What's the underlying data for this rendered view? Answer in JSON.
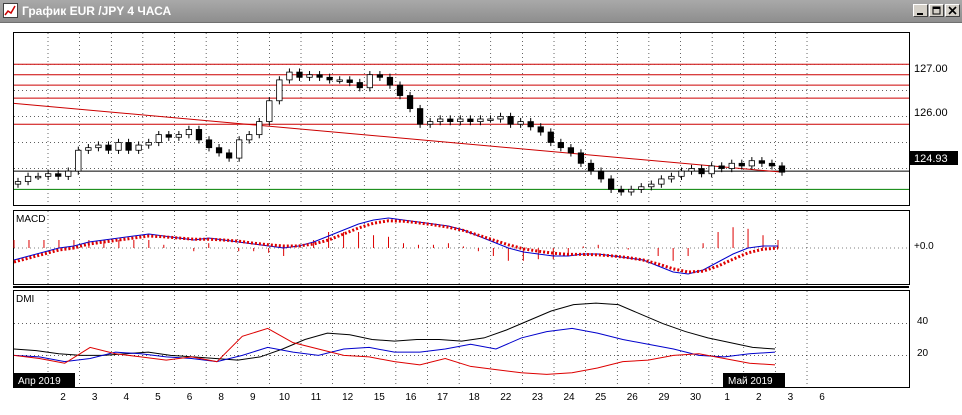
{
  "window": {
    "title": "График EUR /JPY  4 ЧАСА",
    "icons": {
      "app": "chart-app-icon",
      "minimize": "minimize-icon",
      "restore": "restore-icon",
      "close": "close-icon"
    }
  },
  "colors": {
    "candle_up": "#ffffff",
    "candle_down": "#000000",
    "resistance": "#cc0000",
    "support": "#008000",
    "trendline": "#cc0000",
    "macd_line": "#0000cc",
    "macd_signal": "#dd0000",
    "dmi_adx": "#000000",
    "dmi_plus": "#0000cc",
    "dmi_minus": "#dd0000",
    "price_badge_bg": "#000000",
    "price_badge_fg": "#ffffff"
  },
  "price_panel": {
    "current_price": "124.93",
    "ticks": [
      "127.00",
      "126.00"
    ]
  },
  "macd_panel": {
    "label": "MACD",
    "ticks": [
      "+0.0"
    ]
  },
  "dmi_panel": {
    "label": "DMI",
    "ticks": [
      "40",
      "20"
    ]
  },
  "time_axis": {
    "month_labels": [
      "Апр 2019",
      "Май 2019"
    ],
    "day_labels": [
      "2",
      "3",
      "4",
      "5",
      "6",
      "8",
      "9",
      "10",
      "11",
      "12",
      "15",
      "16",
      "17",
      "18",
      "22",
      "23",
      "24",
      "25",
      "26",
      "29",
      "30",
      "1",
      "2",
      "3",
      "6"
    ]
  },
  "chart_data": {
    "type": "candlestick",
    "symbol": "EUR/JPY",
    "timeframe": "4H",
    "y_range": [
      124.3,
      127.6
    ],
    "horizontal_levels": [
      {
        "value": 127.0,
        "color": "#cc0000"
      },
      {
        "value": 126.8,
        "color": "#cc0000"
      },
      {
        "value": 126.6,
        "color": "#cc0000"
      },
      {
        "value": 126.35,
        "color": "#cc0000"
      },
      {
        "value": 125.85,
        "color": "#cc0000"
      },
      {
        "value": 124.95,
        "color": "#000000"
      },
      {
        "value": 124.6,
        "color": "#008000"
      }
    ],
    "trendline": [
      {
        "x": 0,
        "y": 126.25
      },
      {
        "x": 91,
        "y": 124.93
      }
    ],
    "close_path": [
      124.75,
      124.85,
      124.85,
      124.9,
      124.85,
      124.95,
      125.35,
      125.4,
      125.45,
      125.35,
      125.5,
      125.35,
      125.45,
      125.5,
      125.65,
      125.6,
      125.65,
      125.75,
      125.55,
      125.4,
      125.3,
      125.2,
      125.55,
      125.65,
      125.9,
      126.3,
      126.7,
      126.85,
      126.75,
      126.8,
      126.75,
      126.7,
      126.7,
      126.65,
      126.55,
      126.8,
      126.75,
      126.6,
      126.4,
      126.15,
      125.85,
      125.9,
      125.95,
      125.9,
      125.95,
      125.9,
      125.95,
      125.95,
      126.0,
      125.85,
      125.9,
      125.8,
      125.7,
      125.5,
      125.4,
      125.3,
      125.1,
      124.95,
      124.8,
      124.6,
      124.55,
      124.6,
      124.65,
      124.7,
      124.8,
      124.85,
      124.95,
      125.0,
      124.9,
      125.05,
      125.0,
      125.1,
      125.05,
      125.15,
      125.1,
      125.05,
      124.93
    ],
    "macd": {
      "y_range": [
        -0.9,
        0.9
      ],
      "line": [
        -0.3,
        -0.2,
        -0.1,
        0.0,
        0.05,
        0.15,
        0.2,
        0.25,
        0.3,
        0.35,
        0.3,
        0.25,
        0.2,
        0.25,
        0.2,
        0.15,
        0.1,
        0.05,
        0.0,
        0.05,
        0.15,
        0.3,
        0.45,
        0.6,
        0.7,
        0.75,
        0.7,
        0.65,
        0.6,
        0.55,
        0.45,
        0.3,
        0.15,
        0.0,
        -0.1,
        -0.15,
        -0.2,
        -0.2,
        -0.15,
        -0.15,
        -0.2,
        -0.25,
        -0.3,
        -0.45,
        -0.6,
        -0.65,
        -0.55,
        -0.35,
        -0.15,
        0.0,
        0.05,
        0.05
      ],
      "signal": [
        -0.35,
        -0.25,
        -0.15,
        -0.05,
        0.0,
        0.1,
        0.15,
        0.2,
        0.25,
        0.3,
        0.28,
        0.25,
        0.22,
        0.22,
        0.2,
        0.17,
        0.12,
        0.08,
        0.05,
        0.05,
        0.1,
        0.2,
        0.35,
        0.5,
        0.62,
        0.68,
        0.67,
        0.63,
        0.58,
        0.52,
        0.44,
        0.32,
        0.2,
        0.08,
        -0.02,
        -0.08,
        -0.13,
        -0.16,
        -0.16,
        -0.17,
        -0.2,
        -0.24,
        -0.3,
        -0.4,
        -0.52,
        -0.6,
        -0.58,
        -0.45,
        -0.28,
        -0.12,
        -0.03,
        0.0
      ]
    },
    "dmi": {
      "y_range": [
        0,
        60
      ],
      "adx": [
        24,
        23,
        21,
        20,
        20,
        21,
        22,
        20,
        19,
        18,
        17,
        19,
        24,
        30,
        34,
        33,
        30,
        29,
        30,
        30,
        29,
        31,
        36,
        42,
        48,
        52,
        53,
        52,
        46,
        40,
        35,
        31,
        28,
        25,
        24
      ],
      "plus_di": [
        20,
        19,
        16,
        18,
        22,
        21,
        19,
        18,
        16,
        20,
        25,
        22,
        20,
        24,
        25,
        22,
        22,
        24,
        27,
        24,
        31,
        35,
        37,
        34,
        30,
        27,
        24,
        20,
        19,
        21,
        22
      ],
      "minus_di": [
        20,
        18,
        15,
        25,
        21,
        19,
        17,
        19,
        16,
        32,
        37,
        28,
        24,
        20,
        19,
        16,
        14,
        18,
        13,
        11,
        9,
        8,
        9,
        12,
        16,
        17,
        20,
        21,
        18,
        15,
        14
      ]
    }
  }
}
